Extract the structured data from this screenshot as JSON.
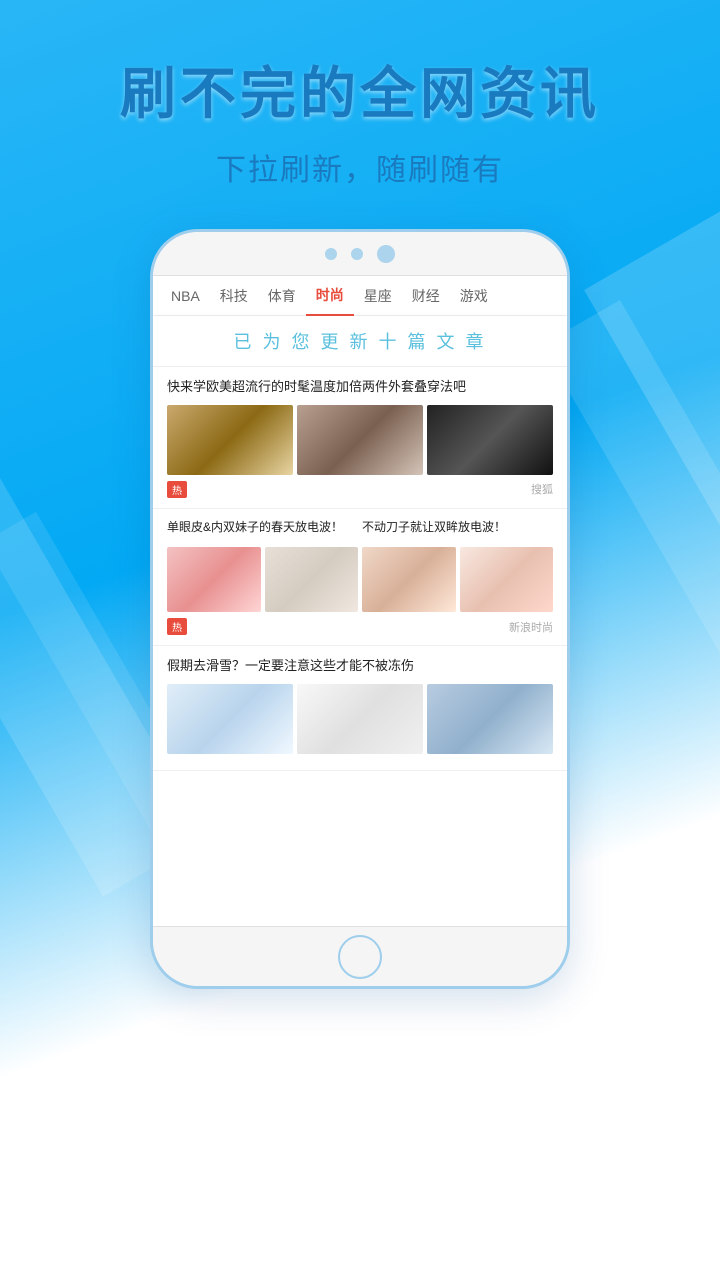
{
  "header": {
    "main_title": "刷不完的全网资讯",
    "sub_title": "下拉刷新，随刷随有"
  },
  "phone": {
    "tabs": [
      {
        "label": "NBA",
        "active": false
      },
      {
        "label": "科技",
        "active": false
      },
      {
        "label": "体育",
        "active": false
      },
      {
        "label": "时尚",
        "active": true
      },
      {
        "label": "星座",
        "active": false
      },
      {
        "label": "财经",
        "active": false
      },
      {
        "label": "游戏",
        "active": false
      }
    ],
    "refresh_banner": "已 为 您 更 新 十 篇 文 章",
    "articles": [
      {
        "id": 1,
        "title": "快来学欧美超流行的时髦温度加倍两件外套叠穿法吧",
        "images": [
          "fashion1",
          "fashion2",
          "fashion3"
        ],
        "has_hot": true,
        "source": "搜狐"
      },
      {
        "id": 2,
        "left": {
          "title": "单眼皮&内双妹子的春天放电波！",
          "image": "girl1"
        },
        "right": {
          "title": "不动刀子就让双眸放电波！",
          "image": "girl3"
        },
        "has_hot": true,
        "source": "新浪时尚",
        "type": "twocol"
      },
      {
        "id": 3,
        "title": "假期去滑雪？一定要注意这些才能不被冻伤",
        "images": [
          "snow1",
          "snow2",
          "snow3"
        ],
        "has_hot": false,
        "source": ""
      }
    ]
  }
}
